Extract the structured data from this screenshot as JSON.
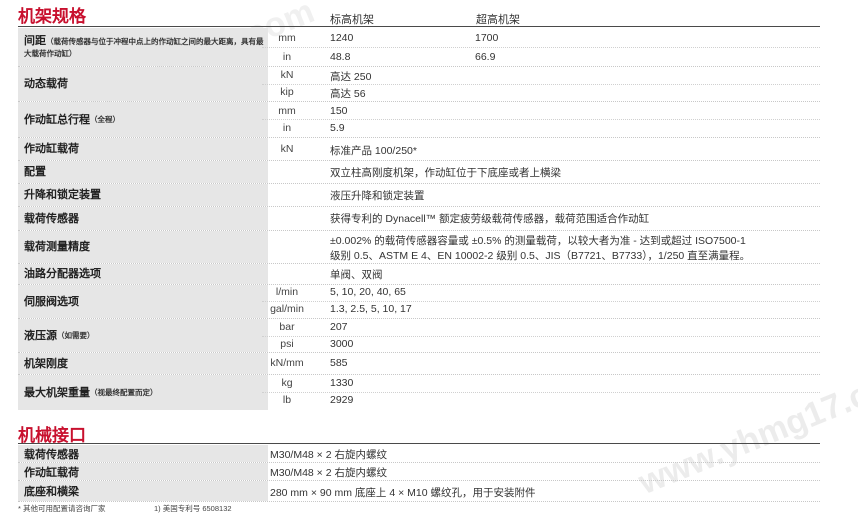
{
  "section1": {
    "title": "机架规格",
    "col_standard": "标高机架",
    "col_extra": "超高机架",
    "rows": [
      {
        "label": "间距",
        "note": "（载荷传感器与位于冲程中点上的作动缸之间的最大距离，具有最大载荷作动缸）",
        "units": [
          "mm",
          "in"
        ],
        "values": [
          "1240",
          "48.8"
        ],
        "values2": [
          "1700",
          "66.9"
        ]
      },
      {
        "label": "动态载荷",
        "units": [
          "kN",
          "kip"
        ],
        "values": [
          "高达 250",
          "高达 56"
        ]
      },
      {
        "label": "作动缸总行程",
        "note": "（全程）",
        "units": [
          "mm",
          "in"
        ],
        "values": [
          "150",
          "5.9"
        ]
      },
      {
        "label": "作动缸载荷",
        "units": [
          "kN"
        ],
        "values": [
          "标准产品 100/250*"
        ]
      },
      {
        "label": "配置",
        "values": [
          "双立柱高刚度机架，作动缸位于下底座或者上横梁"
        ]
      },
      {
        "label": "升降和锁定装置",
        "values": [
          "液压升降和锁定装置"
        ]
      },
      {
        "label": "载荷传感器",
        "values": [
          "获得专利的 Dynacell™ 额定疲劳级载荷传感器，载荷范围适合作动缸"
        ]
      },
      {
        "label": "载荷测量精度",
        "values": [
          "±0.002% 的载荷传感器容量或 ±0.5% 的测量载荷，以较大者为准 - 达到或超过 ISO7500-1",
          "级别 0.5、ASTM E 4、EN 10002-2 级别 0.5、JIS（B7721、B7733），1/250 直至满量程。"
        ]
      },
      {
        "label": "油路分配器选项",
        "values": [
          "单阀、双阀"
        ]
      },
      {
        "label": "伺服阀选项",
        "units": [
          "l/min",
          "gal/min"
        ],
        "values": [
          "5, 10, 20, 40, 65",
          "1.3, 2.5, 5, 10, 17"
        ]
      },
      {
        "label": "液压源",
        "note": "（如需要）",
        "units": [
          "bar",
          "psi"
        ],
        "values": [
          "207",
          "3000"
        ]
      },
      {
        "label": "机架刚度",
        "units": [
          "kN/mm"
        ],
        "values": [
          "585"
        ]
      },
      {
        "label": "最大机架重量",
        "note": "（视最终配置而定）",
        "units": [
          "kg",
          "lb"
        ],
        "values": [
          "1330",
          "2929"
        ]
      }
    ]
  },
  "section2": {
    "title": "机械接口",
    "rows": [
      {
        "label": "载荷传感器",
        "value": "M30/M48 × 2 右旋内螺纹"
      },
      {
        "label": "作动缸载荷",
        "value": "M30/M48 × 2 右旋内螺纹"
      },
      {
        "label": "底座和横梁",
        "value": "280 mm × 90 mm 底座上 4 × M10 螺纹孔，用于安装附件"
      }
    ]
  },
  "footnotes": [
    "* 其他可用配置请咨询厂家",
    "1) 美国专利号 6508132"
  ],
  "watermark": "www.yhmg17.com"
}
